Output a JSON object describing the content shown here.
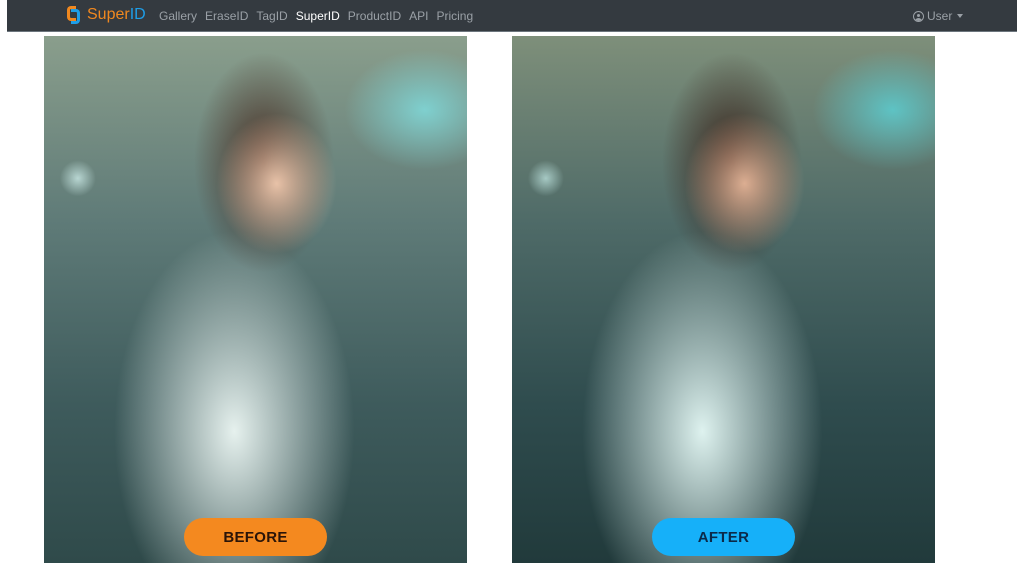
{
  "navbar": {
    "brand": {
      "part1": "Super",
      "part2": "ID"
    },
    "links": [
      {
        "label": "Gallery",
        "active": false
      },
      {
        "label": "EraseID",
        "active": false
      },
      {
        "label": "TagID",
        "active": false
      },
      {
        "label": "SuperID",
        "active": true
      },
      {
        "label": "ProductID",
        "active": false
      },
      {
        "label": "API",
        "active": false
      },
      {
        "label": "Pricing",
        "active": false
      }
    ],
    "user_label": "User"
  },
  "comparison": {
    "before": {
      "label": "BEFORE",
      "color": "#f4891f",
      "image_desc": "Portrait of woman in white top, original"
    },
    "after": {
      "label": "AFTER",
      "color": "#16b0f9",
      "image_desc": "Portrait of woman in white top, enhanced"
    }
  }
}
